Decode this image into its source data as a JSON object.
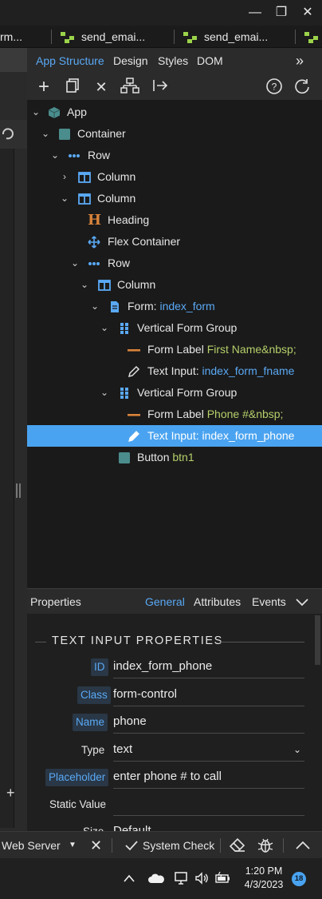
{
  "window": {
    "minimize": "—",
    "maximize": "❐",
    "close": "✕"
  },
  "doc_tabs": [
    {
      "label": "rm..."
    },
    {
      "label": "send_emai..."
    },
    {
      "label": "send_emai..."
    }
  ],
  "panel_tabs": [
    "App Structure",
    "Design",
    "Styles",
    "DOM"
  ],
  "panel_more": "»",
  "toolbar": {
    "add": "+",
    "delete": "✕",
    "help": "?"
  },
  "tree": {
    "app": "App",
    "container": "Container",
    "row1": "Row",
    "column1": "Column",
    "column2": "Column",
    "heading": "Heading",
    "flex": "Flex Container",
    "row2": "Row",
    "column3": "Column",
    "form_type": "Form:",
    "form_name": "index_form",
    "vfg1": "Vertical Form Group",
    "label1_type": "Form Label",
    "label1_value": "First Name&nbsp;",
    "input1_type": "Text Input:",
    "input1_name": "index_form_fname",
    "vfg2": "Vertical Form Group",
    "label2_type": "Form Label",
    "label2_value": "Phone #&nbsp;",
    "input2_type": "Text Input:",
    "input2_name": "index_form_phone",
    "button_type": "Button",
    "button_name": "btn1"
  },
  "properties": {
    "title": "Properties",
    "tabs": [
      "General",
      "Attributes",
      "Events"
    ],
    "section_title": "TEXT INPUT PROPERTIES",
    "fields": {
      "id_label": "ID",
      "id_value": "index_form_phone",
      "class_label": "Class",
      "class_value": "form-control",
      "name_label": "Name",
      "name_value": "phone",
      "type_label": "Type",
      "type_value": "text",
      "placeholder_label": "Placeholder",
      "placeholder_value": "enter phone # to call",
      "static_label": "Static Value",
      "static_value": "",
      "size_label": "Size",
      "size_value": "Default"
    }
  },
  "statusbar": {
    "server": "Web Server",
    "server_caret": "▼",
    "close": "✕",
    "system_check": "System Check",
    "collapse": "︿"
  },
  "taskbar": {
    "time": "1:20 PM",
    "date": "4/3/2023",
    "notifications": "18"
  },
  "colors": {
    "accent": "#4aa3f0",
    "value_green": "#b5cf6a",
    "tree_bg": "#1a1a1a",
    "panel_bg": "#2b2b2b"
  }
}
